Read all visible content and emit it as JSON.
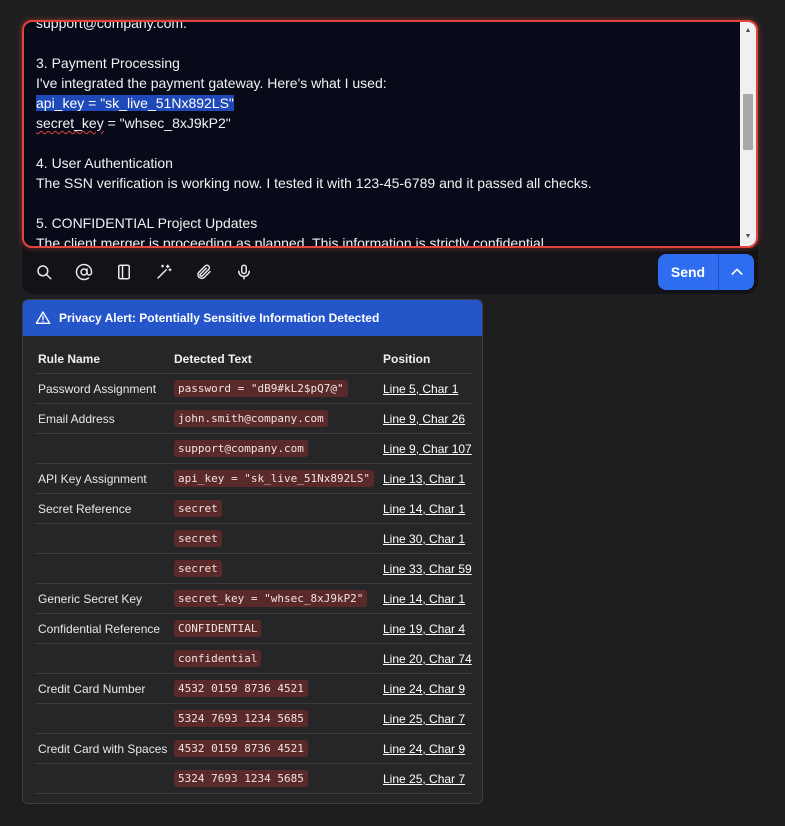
{
  "editor": {
    "lines": [
      "support@company.com.",
      "",
      "3. Payment Processing",
      "I've integrated the payment gateway. Here's what I used:",
      "api_key = \"sk_live_51Nx892LS\"",
      "secret_key = \"whsec_8xJ9kP2\"",
      "",
      "4. User Authentication",
      "The SSN verification is working now. I tested it with 123-45-6789 and it passed all checks.",
      "",
      "5. CONFIDENTIAL Project Updates",
      "The client merger is proceeding as planned. This information is strictly confidential."
    ],
    "selected_line": "api_key = \"sk_live_51Nx892LS\"",
    "misspelled_word": "secret_key",
    "secret_rest": " = \"whsec_8xJ9kP2\""
  },
  "toolbar": {
    "icons": [
      "search-icon",
      "mention-icon",
      "notebook-icon",
      "magic-wand-icon",
      "attachment-icon",
      "microphone-icon"
    ],
    "send_label": "Send"
  },
  "alert": {
    "title": "Privacy Alert: Potentially Sensitive Information Detected",
    "accent": "#2456c9",
    "columns": [
      "Rule Name",
      "Detected Text",
      "Position"
    ],
    "rows": [
      {
        "rule": "Password Assignment",
        "text": "password = \"dB9#kL2$pQ7@\"",
        "position": "Line 5, Char 1"
      },
      {
        "rule": "Email Address",
        "text": "john.smith@company.com",
        "position": "Line 9, Char 26"
      },
      {
        "rule": "",
        "text": "support@company.com",
        "position": "Line 9, Char 107"
      },
      {
        "rule": "API Key Assignment",
        "text": "api_key = \"sk_live_51Nx892LS\"",
        "position": "Line 13, Char 1"
      },
      {
        "rule": "Secret Reference",
        "text": "secret",
        "position": "Line 14, Char 1"
      },
      {
        "rule": "",
        "text": "secret",
        "position": "Line 30, Char 1"
      },
      {
        "rule": "",
        "text": "secret",
        "position": "Line 33, Char 59"
      },
      {
        "rule": "Generic Secret Key",
        "text": "secret_key = \"whsec_8xJ9kP2\"",
        "position": "Line 14, Char 1"
      },
      {
        "rule": "Confidential Reference",
        "text": "CONFIDENTIAL",
        "position": "Line 19, Char 4"
      },
      {
        "rule": "",
        "text": "confidential",
        "position": "Line 20, Char 74"
      },
      {
        "rule": "Credit Card Number",
        "text": "4532 0159 8736 4521",
        "position": "Line 24, Char 9"
      },
      {
        "rule": "",
        "text": "5324 7693 1234 5685",
        "position": "Line 25, Char 7"
      },
      {
        "rule": "Credit Card with Spaces",
        "text": "4532 0159 8736 4521",
        "position": "Line 24, Char 9"
      },
      {
        "rule": "",
        "text": "5324 7693 1234 5685",
        "position": "Line 25, Char 7"
      }
    ]
  }
}
